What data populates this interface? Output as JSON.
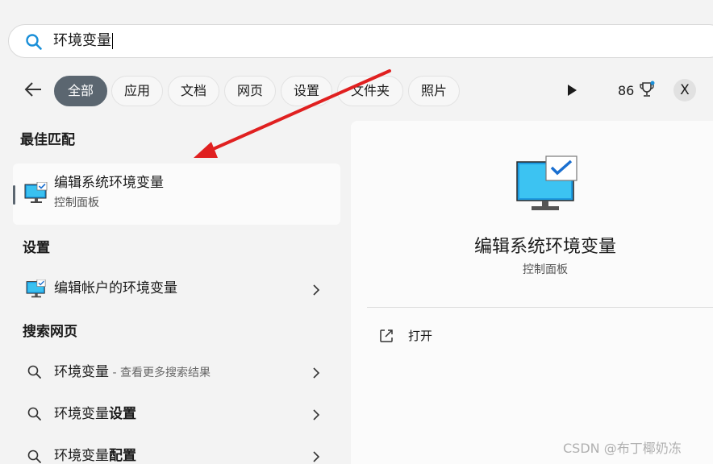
{
  "search": {
    "value": "环境变量"
  },
  "filters": [
    "全部",
    "应用",
    "文档",
    "网页",
    "设置",
    "文件夹",
    "照片"
  ],
  "points": "86",
  "close_label": "X",
  "best_match": {
    "section": "最佳匹配",
    "name": "编辑系统环境变量",
    "subtitle": "控制面板"
  },
  "settings": {
    "section": "设置",
    "items": [
      "编辑帐户的环境变量"
    ]
  },
  "web": {
    "section": "搜索网页",
    "items": [
      {
        "prefix": "环境变量",
        "suffix": " - 查看更多搜索结果",
        "bold": ""
      },
      {
        "prefix": "环境变量",
        "suffix": "",
        "bold": "设置"
      },
      {
        "prefix": "环境变量",
        "suffix": "",
        "bold": "配置"
      }
    ]
  },
  "detail": {
    "title": "编辑系统环境变量",
    "subtitle": "控制面板",
    "open_label": "打开"
  },
  "watermark": "CSDN @布丁椰奶冻",
  "colors": {
    "accent": "#5b6670",
    "annotation_arrow": "#e02020",
    "icon_blue": "#1e9be0"
  }
}
